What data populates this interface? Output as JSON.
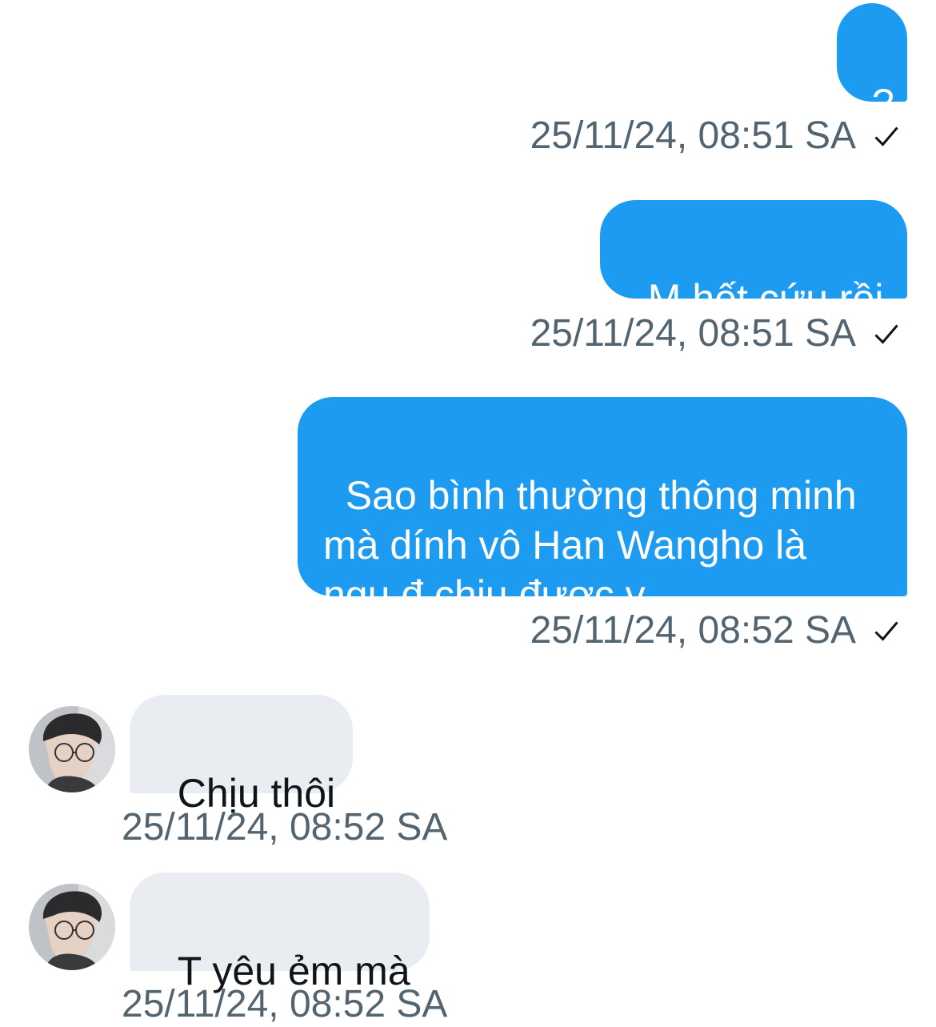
{
  "conversation": {
    "messages": [
      {
        "direction": "outgoing",
        "text": "?",
        "timestamp": "25/11/24, 08:51 SA",
        "status_icon": "sent-check-icon"
      },
      {
        "direction": "outgoing",
        "text": "M hết cứu rồi",
        "timestamp": "25/11/24, 08:51 SA",
        "status_icon": "sent-check-icon"
      },
      {
        "direction": "outgoing",
        "text": "Sao bình thường thông minh\nmà dính vô Han Wangho là\nngu đ chịu được v",
        "timestamp": "25/11/24, 08:52 SA",
        "status_icon": "sent-check-icon"
      },
      {
        "direction": "incoming",
        "text": "Chịu thôi",
        "timestamp": "25/11/24, 08:52 SA",
        "avatar": "contact-avatar"
      },
      {
        "direction": "incoming",
        "text": "T yêu ẻm mà",
        "timestamp": "25/11/24, 08:52 SA",
        "avatar": "contact-avatar"
      }
    ]
  },
  "colors": {
    "outgoing_bubble": "#1d9bf0",
    "incoming_bubble": "#e9edf1",
    "timestamp_text": "#536471",
    "background": "#ffffff"
  }
}
